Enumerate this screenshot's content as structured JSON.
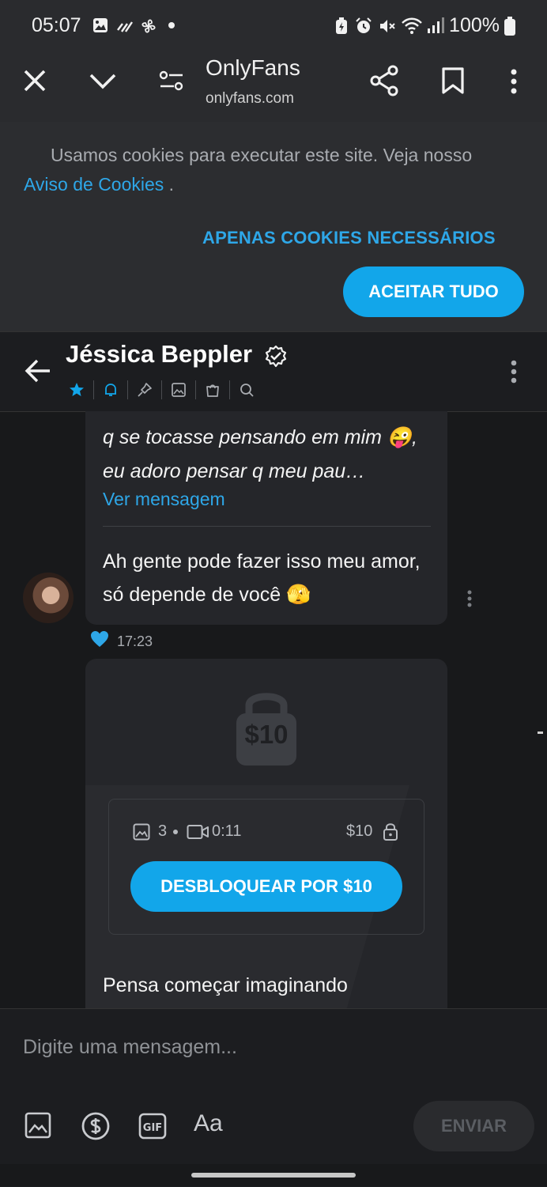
{
  "status_bar": {
    "time": "05:07",
    "battery": "100%"
  },
  "browser": {
    "title": "OnlyFans",
    "url": "onlyfans.com"
  },
  "cookie_banner": {
    "text": "Usamos cookies para executar este site. Veja nosso",
    "link": "Aviso de Cookies",
    "link_suffix": " .",
    "necessary_button": "APENAS COOKIES NECESSÁRIOS",
    "accept_button": "ACEITAR TUDO"
  },
  "chat": {
    "name": "Jéssica Beppler",
    "messages": [
      {
        "quoted_text": "q se tocasse pensando em mim 😜, eu adoro pensar q meu pau…",
        "see_message": "Ver mensagem",
        "text": "Ah gente pode fazer isso meu amor, só depende de você 🫣",
        "time": "17:23"
      }
    ],
    "locked": {
      "lock_price": "$10",
      "photos": "3",
      "video_duration": "0:11",
      "price": "$10",
      "unlock_button": "DESBLOQUEAR POR $10",
      "caption_partial": "Pensa começar imaginando"
    }
  },
  "composer": {
    "placeholder": "Digite uma mensagem...",
    "font_button": "Aa",
    "send_button": "ENVIAR"
  },
  "colors": {
    "accent": "#12a6ea",
    "link": "#2ea7e8",
    "background": "#18191b",
    "bubble": "#25262a"
  }
}
